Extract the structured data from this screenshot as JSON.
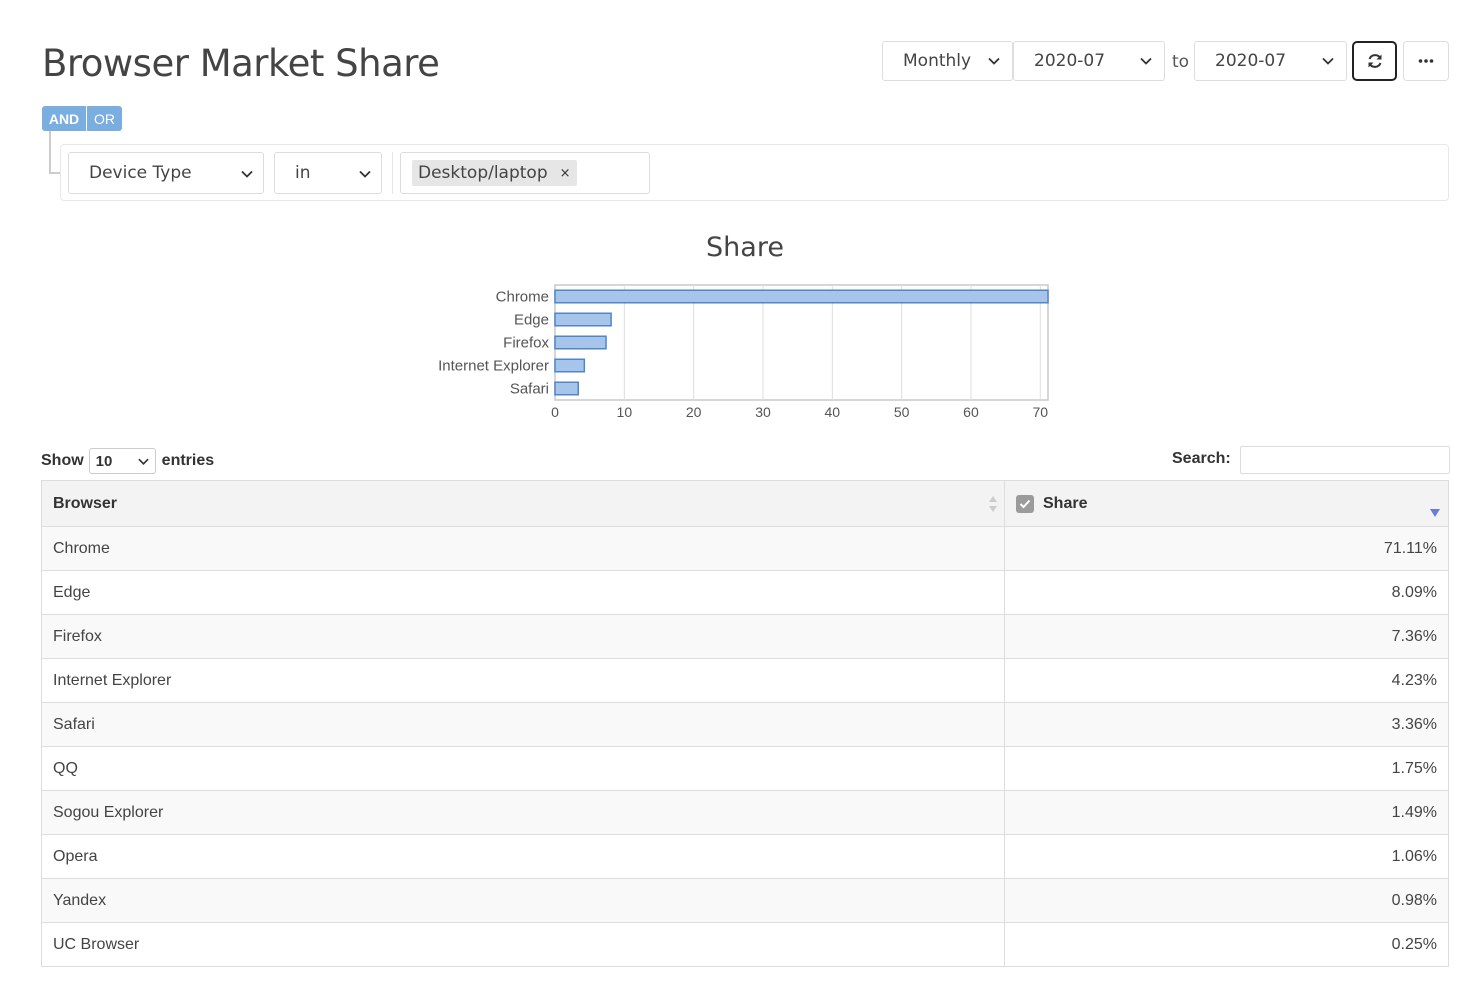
{
  "page": {
    "title": "Browser Market Share"
  },
  "controls": {
    "period": "Monthly",
    "from": "2020-07",
    "to_label": "to",
    "to": "2020-07",
    "refresh_icon": "refresh-icon",
    "more_icon": "ellipsis-icon"
  },
  "filter": {
    "and_label": "AND",
    "or_label": "OR",
    "field": "Device Type",
    "operator": "in",
    "value": "Desktop/laptop",
    "remove_glyph": "×"
  },
  "chart_data": {
    "type": "bar",
    "orientation": "horizontal",
    "title": "Share",
    "categories": [
      "Chrome",
      "Edge",
      "Firefox",
      "Internet Explorer",
      "Safari"
    ],
    "values": [
      71.11,
      8.09,
      7.36,
      4.23,
      3.36
    ],
    "xlim": [
      0,
      71.11
    ],
    "xticks": [
      0,
      10,
      20,
      30,
      40,
      50,
      60,
      70
    ],
    "grid": true,
    "bar_color": "#a7c5ea",
    "bar_border": "#4f86c6"
  },
  "table": {
    "show_label": "Show",
    "page_size": "10",
    "entries_label": "entries",
    "search_label": "Search:",
    "columns": [
      "Browser",
      "Share"
    ],
    "rows": [
      [
        "Chrome",
        "71.11%"
      ],
      [
        "Edge",
        "8.09%"
      ],
      [
        "Firefox",
        "7.36%"
      ],
      [
        "Internet Explorer",
        "4.23%"
      ],
      [
        "Safari",
        "3.36%"
      ],
      [
        "QQ",
        "1.75%"
      ],
      [
        "Sogou Explorer",
        "1.49%"
      ],
      [
        "Opera",
        "1.06%"
      ],
      [
        "Yandex",
        "0.98%"
      ],
      [
        "UC Browser",
        "0.25%"
      ]
    ]
  }
}
